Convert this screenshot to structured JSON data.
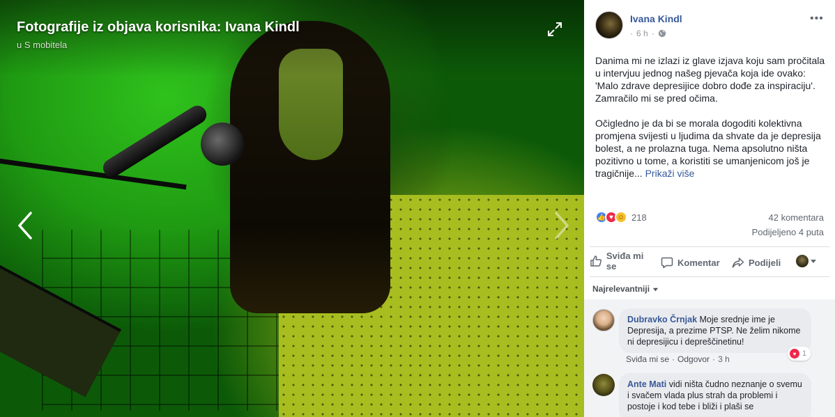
{
  "viewer": {
    "title": "Fotografije iz objava korisnika: Ivana Kindl",
    "subtitle": "u S mobitela",
    "icons": [
      "expand-icon",
      "chevron-left-icon",
      "chevron-right-icon"
    ]
  },
  "post": {
    "author": "Ivana Kindl",
    "time": "6 h",
    "separator": "·",
    "paragraph1": "Danima mi ne izlazi iz glave izjava koju sam pročitala u intervjuu jednog našeg pjevača koja ide ovako: 'Malo zdrave depresijice dobro dođe za inspiraciju'. Zamračilo mi se pred očima.",
    "paragraph2": "Očigledno je da bi se morala dogoditi kolektivna promjena svijesti u ljudima da shvate da je depresija bolest, a ne prolazna tuga. Nema apsolutno ništa pozitivno u tome, a koristiti se umanjenicom još je tragičnije...",
    "see_more": "Prikaži više",
    "reactions_count": "218",
    "comments_count": "42 komentara",
    "shares_count": "Podijeljeno 4 puta"
  },
  "actions": {
    "like": "Sviđa mi se",
    "comment": "Komentar",
    "share": "Podijeli"
  },
  "comments": {
    "sort_label": "Najrelevantniji",
    "items": [
      {
        "name": "Dubravko Črnjak",
        "text": "Moje srednje ime je Depresija, a prezime PTSP. Ne želim nikome ni depresijicu i depreščinetinu!",
        "like": "Sviđa mi se",
        "reply": "Odgovor",
        "time": "3 h",
        "reaction_count": "1"
      },
      {
        "name": "Ante Mati",
        "text": "vidi ništa čudno neznanje o svemu i svačem vlada plus strah da problemi i postoje i kod tebe i bliži i plaši se"
      }
    ]
  },
  "colors": {
    "link": "#365899",
    "panel_bg": "#ffffff",
    "comment_bubble": "#e9ebee",
    "like_blue": "#3b82f6",
    "love_red": "#f0284a"
  }
}
